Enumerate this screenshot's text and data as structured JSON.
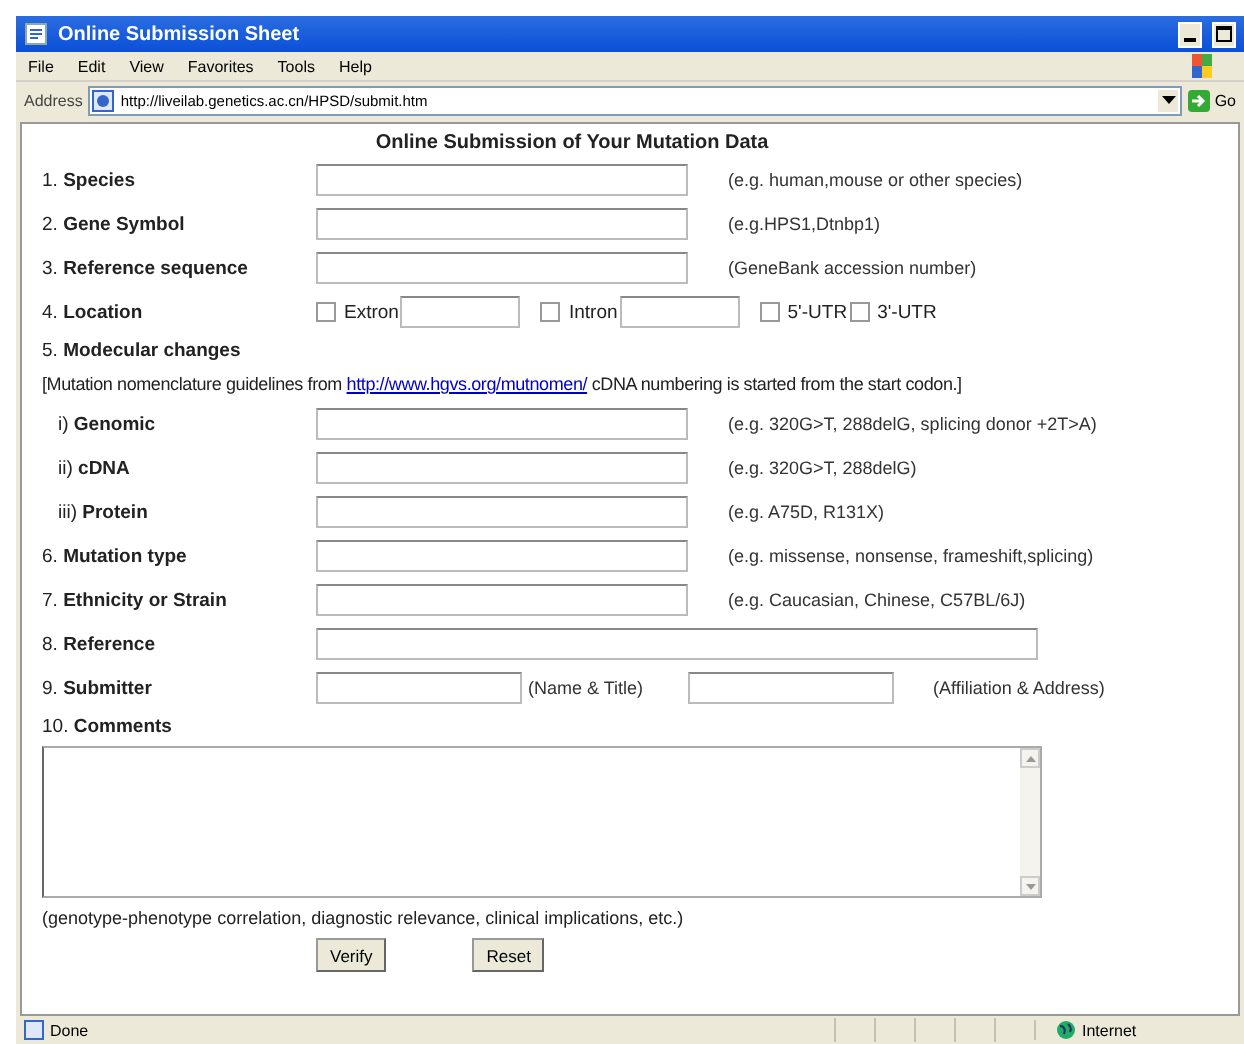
{
  "window": {
    "title": "Online Submission Sheet"
  },
  "menu": [
    "File",
    "Edit",
    "View",
    "Favorites",
    "Tools",
    "Help"
  ],
  "address": {
    "label": "Address",
    "url": "http://liveilab.genetics.ac.cn/HPSD/submit.htm",
    "go": "Go"
  },
  "heading": "Online Submission of Your Mutation Data",
  "rows": [
    {
      "kind": "field",
      "number": "1.",
      "label": "Species",
      "hint": "(e.g. human,mouse or other species)"
    },
    {
      "kind": "field",
      "number": "2.",
      "label": "Gene Symbol",
      "hint": "(e.g.HPS1,Dtnbp1)"
    },
    {
      "kind": "field",
      "number": "3.",
      "label": "Reference sequence",
      "hint": "(GeneBank accession number)"
    },
    {
      "kind": "location",
      "number": "4.",
      "label": "Location",
      "options": [
        {
          "kind": "with-field",
          "label": "Extron",
          "checked": false
        },
        {
          "kind": "with-field",
          "label": "Intron",
          "checked": false
        },
        {
          "kind": "plain",
          "label": "5'-UTR",
          "checked": false
        },
        {
          "kind": "plain",
          "label": "3'-UTR",
          "checked": false
        }
      ]
    },
    {
      "kind": "section",
      "number": "5.",
      "label": "Modecular changes"
    },
    {
      "kind": "guideline",
      "before": "[Mutation nomenclature guidelines from",
      "link": "http://www.hgvs.org/mutnomen/",
      "after": "cDNA numbering is started from the start codon.]"
    },
    {
      "kind": "subfield",
      "number": "i)",
      "label": "Genomic",
      "hint": "(e.g. 320G>T, 288delG, splicing donor +2T>A)"
    },
    {
      "kind": "subfield",
      "number": "ii)",
      "label": "cDNA",
      "hint": "(e.g. 320G>T, 288delG)"
    },
    {
      "kind": "subfield",
      "number": "iii)",
      "label": "Protein",
      "hint": "(e.g. A75D, R131X)"
    },
    {
      "kind": "field",
      "number": "6.",
      "label": "Mutation type",
      "hint": "(e.g. missense, nonsense, frameshift,splicing)"
    },
    {
      "kind": "field",
      "number": "7.",
      "label": "Ethnicity or Strain",
      "hint": "(e.g. Caucasian, Chinese, C57BL/6J)"
    },
    {
      "kind": "wide",
      "number": "8.",
      "label": "Reference"
    },
    {
      "kind": "pair",
      "number": "9.",
      "label": "Submitter",
      "hints": [
        "(Name & Title)",
        "(Affiliation & Address)"
      ]
    },
    {
      "kind": "textarea",
      "number": "10.",
      "label": "Comments",
      "note": "(genotype-phenotype correlation, diagnostic relevance, clinical implications, etc.)"
    }
  ],
  "buttons": [
    "Verify",
    "Reset"
  ],
  "status_bar": {
    "text": "Done",
    "zone": "Internet"
  }
}
